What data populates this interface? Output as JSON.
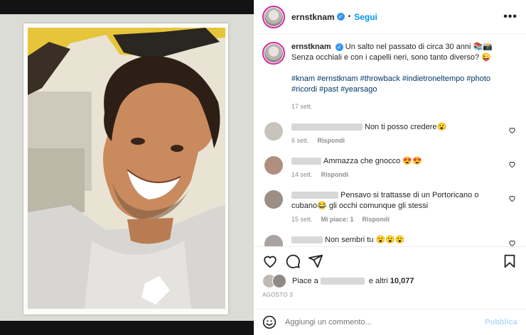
{
  "post": {
    "username": "ernstknam",
    "follow_label": "Segui",
    "more_label": "•••",
    "separator": "•"
  },
  "caption": {
    "username": "ernstknam",
    "text_line1": "Un salto nel passato di circa 30 anni 📚📸",
    "text_line2": "Senza occhiali e con i capelli neri, sono tanto diverso? 😜",
    "hashtags": "#knam #ernstknam #throwback #indietroneltempo #photo #ricordi #past #yearsago",
    "time": "17 sett."
  },
  "comments": [
    {
      "text": "Non ti posso credere😮",
      "time": "6 sett.",
      "reply": "Rispondi",
      "likes": ""
    },
    {
      "text": "Ammazza che gnocco 😍😍",
      "time": "14 sett.",
      "reply": "Rispondi",
      "likes": ""
    },
    {
      "text": "Pensavo si trattasse di un Portoricano o cubano😂 gli occhi comunque gli stessi",
      "time": "15 sett.",
      "reply": "Rispondi",
      "likes": "Mi piace: 1"
    },
    {
      "text": "Non sembri tu 😮😮😮",
      "time": "",
      "reply": "",
      "likes": ""
    }
  ],
  "likes": {
    "prefix": "Piace a",
    "suffix": "e altri",
    "count": "10,077"
  },
  "date": "AGOSTO 3",
  "add_comment": {
    "placeholder": "Aggiungi un commento...",
    "publish_label": "Pubblica"
  },
  "colors": {
    "accent": "#0095f6",
    "link": "#00376b",
    "muted": "#8e8e8e",
    "publish_disabled": "#b3dbff"
  }
}
